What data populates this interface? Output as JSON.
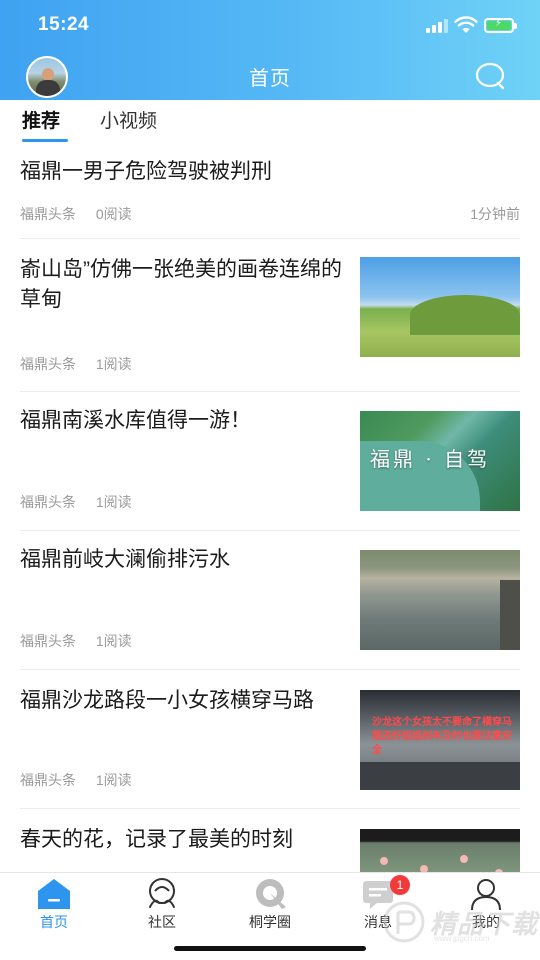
{
  "status_bar": {
    "time": "15:24"
  },
  "header": {
    "title": "首页"
  },
  "tabs": [
    {
      "label": "推荐",
      "active": true
    },
    {
      "label": "小视频",
      "active": false
    }
  ],
  "feed": [
    {
      "title": "福鼎一男子危险驾驶被判刑",
      "source": "福鼎头条",
      "reads": "0阅读",
      "time": "1分钟前"
    },
    {
      "title": "嵛山岛”仿佛一张绝美的画卷连绵的草甸",
      "source": "福鼎头条",
      "reads": "1阅读",
      "thumb": "grassland-island-photo"
    },
    {
      "title": "福鼎南溪水库值得一游！",
      "source": "福鼎头条",
      "reads": "1阅读",
      "thumb": "reservoir-aerial-photo",
      "thumb_caption": "福鼎 · 自驾"
    },
    {
      "title": "福鼎前岐大澜偷排污水",
      "source": "福鼎头条",
      "reads": "1阅读",
      "thumb": "polluted-river-photo"
    },
    {
      "title": "福鼎沙龙路段一小女孩横穿马路",
      "source": "福鼎头条",
      "reads": "1阅读",
      "thumb": "dashcam-road-photo",
      "thumb_caption": "沙龙这个女孩太不要命了横穿马路还好姐姐刹车及时也要注意安全"
    },
    {
      "title": "春天的花，记录了最美的时刻",
      "thumb": "spring-flowers-photo"
    }
  ],
  "tabbar": [
    {
      "label": "首页",
      "icon": "home-icon",
      "active": true
    },
    {
      "label": "社区",
      "icon": "community-icon",
      "active": false
    },
    {
      "label": "桐学圈",
      "icon": "circle-icon",
      "active": false
    },
    {
      "label": "消息",
      "icon": "message-icon",
      "active": false,
      "badge": "1"
    },
    {
      "label": "我的",
      "icon": "profile-icon",
      "active": false
    }
  ],
  "watermark": {
    "text": "精品下载",
    "url": "www.jpgcn.com"
  },
  "colors": {
    "accent": "#2e95ee",
    "header_start": "#3fa2f2",
    "header_end": "#6fd2f7",
    "badge": "#f23a3a"
  }
}
